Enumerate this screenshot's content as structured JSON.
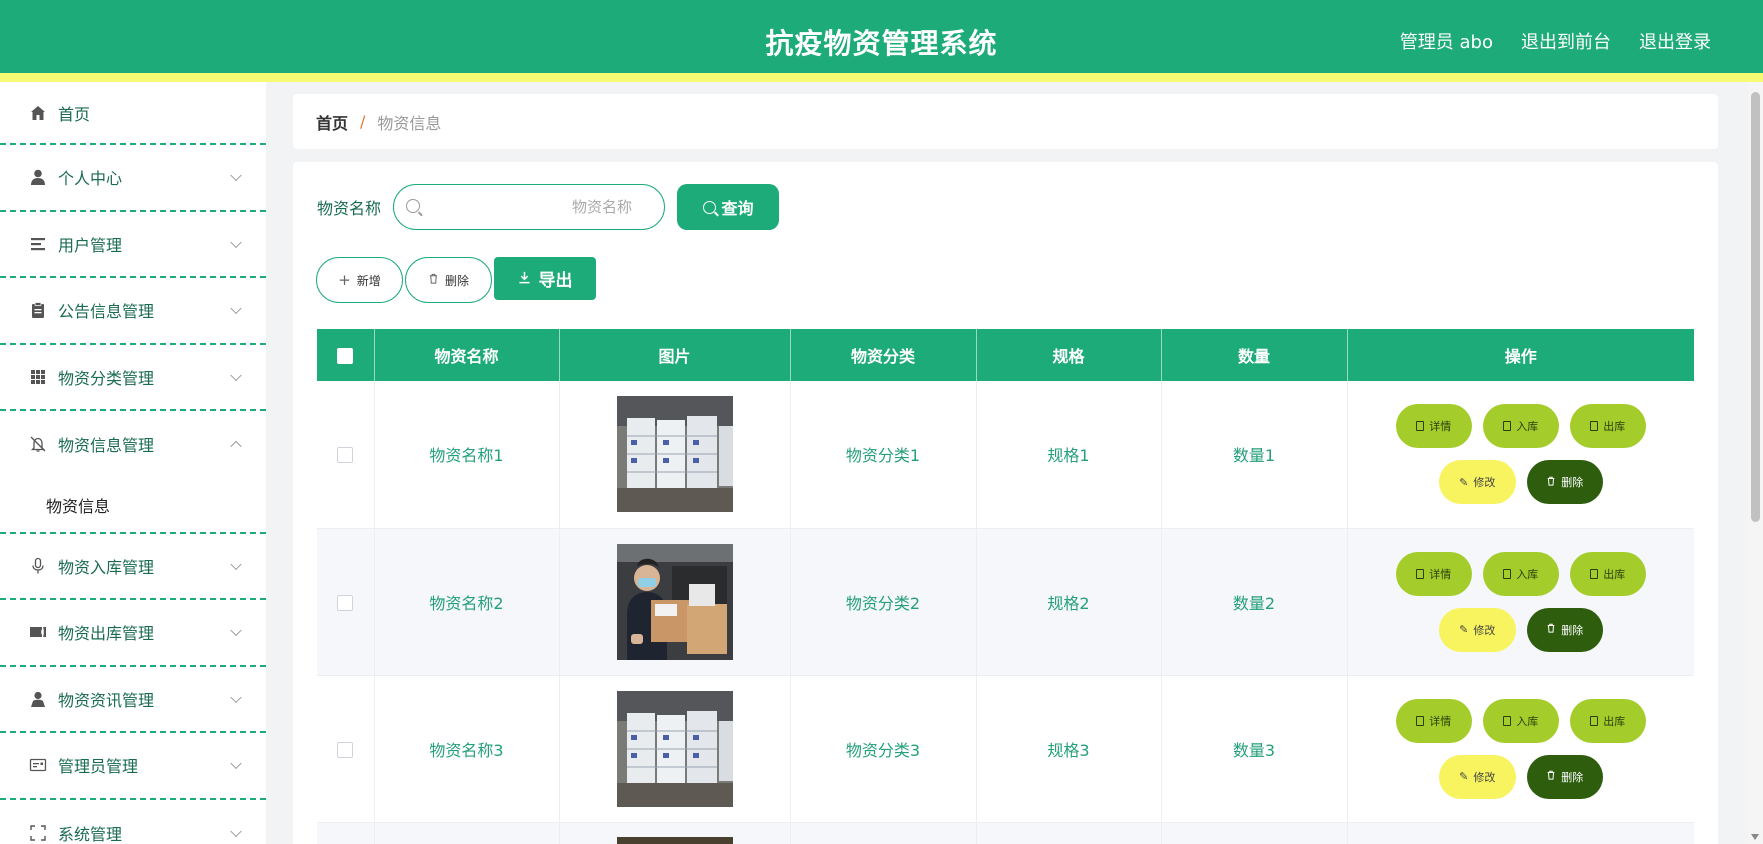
{
  "header": {
    "title": "抗疫物资管理系统",
    "admin_label": "管理员 abo",
    "to_frontend": "退出到前台",
    "logout": "退出登录"
  },
  "sidebar": {
    "items": [
      {
        "label": "首页",
        "icon": "home-icon"
      },
      {
        "label": "个人中心",
        "icon": "user-icon"
      },
      {
        "label": "用户管理",
        "icon": "list-icon"
      },
      {
        "label": "公告信息管理",
        "icon": "clipboard-icon"
      },
      {
        "label": "物资分类管理",
        "icon": "grid-icon"
      },
      {
        "label": "物资信息管理",
        "icon": "bell-off-icon",
        "expanded": true
      },
      {
        "label": "物资入库管理",
        "icon": "microphone-icon"
      },
      {
        "label": "物资出库管理",
        "icon": "ticket-icon"
      },
      {
        "label": "物资资讯管理",
        "icon": "person-icon"
      },
      {
        "label": "管理员管理",
        "icon": "id-card-icon"
      },
      {
        "label": "系统管理",
        "icon": "scan-icon"
      }
    ],
    "sub_items": [
      "物资信息"
    ]
  },
  "breadcrumb": {
    "home": "首页",
    "separator": "/",
    "current": "物资信息"
  },
  "search": {
    "label": "物资名称",
    "placeholder": "物资名称",
    "button": "查询"
  },
  "actions": {
    "add": "新增",
    "delete": "删除",
    "export": "导出"
  },
  "table": {
    "columns": [
      "物资名称",
      "图片",
      "物资分类",
      "规格",
      "数量",
      "操作"
    ],
    "rows": [
      {
        "name": "物资名称1",
        "category": "物资分类1",
        "spec": "规格1",
        "qty": "数量1"
      },
      {
        "name": "物资名称2",
        "category": "物资分类2",
        "spec": "规格2",
        "qty": "数量2"
      },
      {
        "name": "物资名称3",
        "category": "物资分类3",
        "spec": "规格3",
        "qty": "数量3"
      }
    ],
    "row_actions": {
      "detail": "详情",
      "stock_in": "入库",
      "stock_out": "出库",
      "edit": "修改",
      "delete": "删除"
    }
  },
  "colors": {
    "primary": "#1dab79",
    "accent_stripe": "#f7fb73",
    "op_green": "#a4cd2b",
    "op_yellow": "#f8f45f",
    "op_dark": "#2d5d0d"
  }
}
